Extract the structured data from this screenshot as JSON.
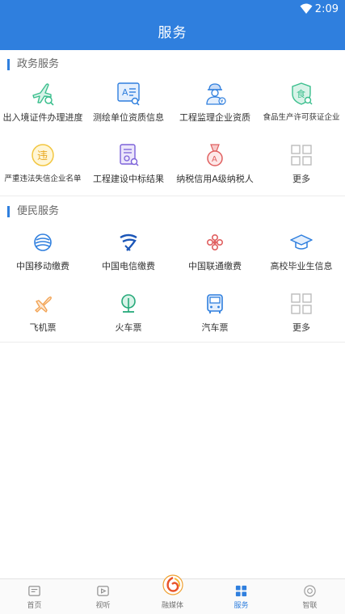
{
  "status_bar": {
    "time": "2:09"
  },
  "header": {
    "title": "服务"
  },
  "sections": [
    {
      "label": "政务服务",
      "items": [
        {
          "label": "出入境证件办理进度",
          "icon": "plane-search-icon"
        },
        {
          "label": "测绘单位资质信息",
          "icon": "survey-doc-icon"
        },
        {
          "label": "工程监理企业资质",
          "icon": "engineer-icon"
        },
        {
          "label": "食品生产许可获证企业",
          "icon": "food-shield-icon"
        },
        {
          "label": "严重违法失信企业名单",
          "icon": "violation-icon"
        },
        {
          "label": "工程建设中标结果",
          "icon": "bid-result-icon"
        },
        {
          "label": "纳税信用A级纳税人",
          "icon": "tax-medal-icon"
        },
        {
          "label": "更多",
          "icon": "more-grid-icon"
        }
      ]
    },
    {
      "label": "便民服务",
      "items": [
        {
          "label": "中国移动缴费",
          "icon": "china-mobile-icon"
        },
        {
          "label": "中国电信缴费",
          "icon": "china-telecom-icon"
        },
        {
          "label": "中国联通缴费",
          "icon": "china-unicom-icon"
        },
        {
          "label": "高校毕业生信息",
          "icon": "graduation-cap-icon"
        },
        {
          "label": "飞机票",
          "icon": "airplane-icon"
        },
        {
          "label": "火车票",
          "icon": "train-icon"
        },
        {
          "label": "汽车票",
          "icon": "bus-icon"
        },
        {
          "label": "更多",
          "icon": "more-grid-icon"
        }
      ]
    }
  ],
  "tabbar": [
    {
      "label": "首页",
      "icon": "home-icon"
    },
    {
      "label": "视听",
      "icon": "video-icon"
    },
    {
      "label": "融媒体",
      "icon": "media-logo-icon"
    },
    {
      "label": "服务",
      "icon": "services-icon",
      "active": true
    },
    {
      "label": "智联",
      "icon": "smart-link-icon"
    }
  ],
  "colors": {
    "primary": "#2f7fde",
    "green": "#3cbf8e",
    "orange": "#f2a455",
    "red": "#e06060"
  }
}
